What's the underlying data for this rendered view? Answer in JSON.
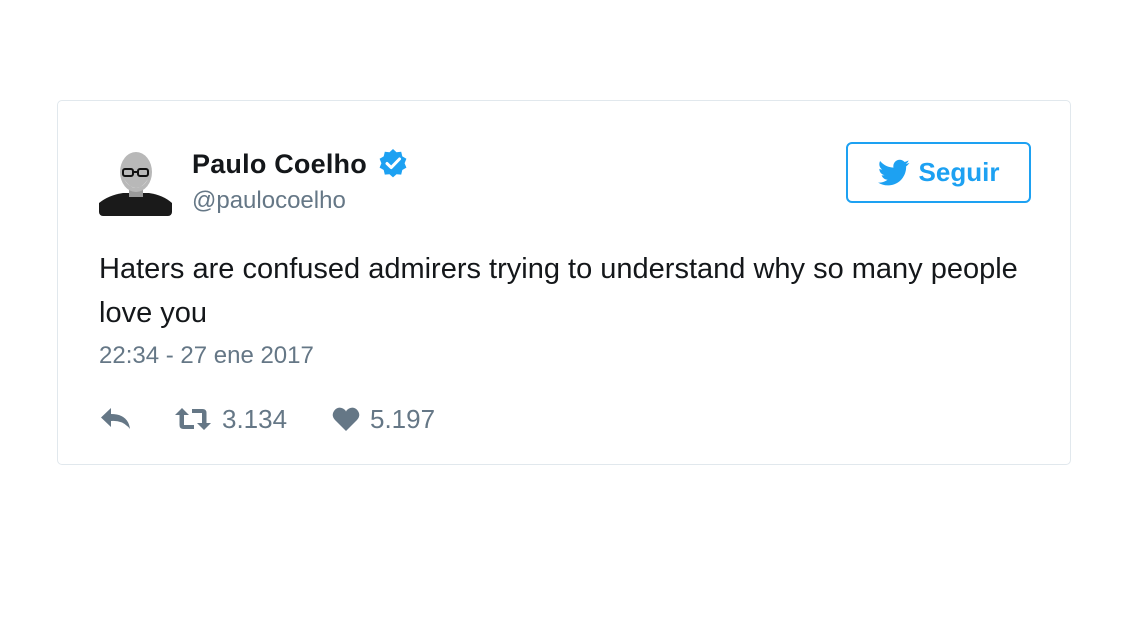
{
  "tweet": {
    "author": {
      "display_name": "Paulo Coelho",
      "handle": "@paulocoelho",
      "verified": true
    },
    "follow_button": {
      "label": "Seguir",
      "icon": "twitter-bird-icon"
    },
    "text": "Haters are confused admirers trying to understand why so many people love you",
    "timestamp": "22:34 - 27 ene 2017",
    "actions": {
      "reply": {
        "icon": "reply-icon"
      },
      "retweet": {
        "icon": "retweet-icon",
        "count": "3.134"
      },
      "like": {
        "icon": "heart-icon",
        "count": "5.197"
      }
    }
  },
  "colors": {
    "accent": "#1da1f2",
    "verified": "#1da1f2",
    "text_primary": "#14171a",
    "text_secondary": "#657786",
    "border": "#e1e8ed"
  }
}
